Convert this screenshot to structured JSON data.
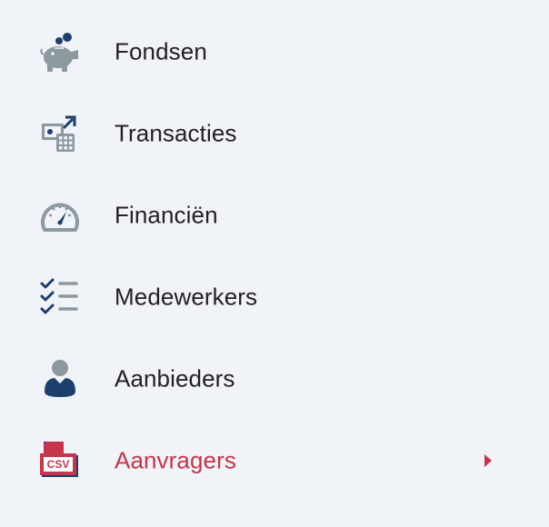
{
  "menu": {
    "items": [
      {
        "label": "Fondsen",
        "icon": "piggy-bank-icon"
      },
      {
        "label": "Transacties",
        "icon": "money-calculator-icon"
      },
      {
        "label": "Financiën",
        "icon": "speedometer-icon"
      },
      {
        "label": "Medewerkers",
        "icon": "checklist-icon"
      },
      {
        "label": "Aanbieders",
        "icon": "user-icon"
      },
      {
        "label": "Aanvragers",
        "icon": "csv-file-icon",
        "active": true
      }
    ]
  },
  "colors": {
    "background": "#f0f3f7",
    "icon_gray": "#8c999f",
    "icon_navy": "#1d3f6e",
    "active": "#c8354a",
    "text": "#222222"
  },
  "csv_icon_text": "CSV"
}
